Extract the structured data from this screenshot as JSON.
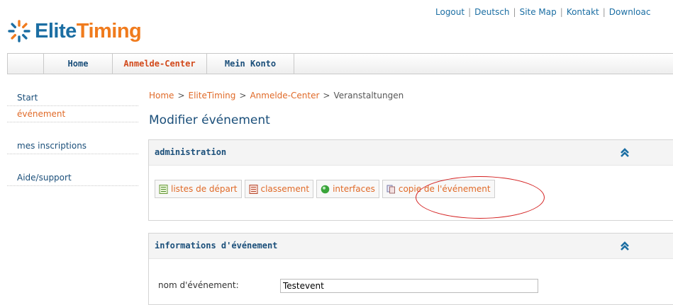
{
  "brand": {
    "part1": "Elite",
    "part2": "Timing",
    "color_blue": "#1b6ea3",
    "color_orange": "#f07b1d",
    "logo_icon": "elitetiming-logo-icon"
  },
  "toplinks": [
    "Logout",
    "Deutsch",
    "Site Map",
    "Kontakt",
    "Downloac"
  ],
  "nav": {
    "tabs": [
      "Home",
      "Anmelde-Center",
      "Mein Konto"
    ]
  },
  "sidebar": {
    "items": [
      "Start",
      "événement",
      "mes inscriptions",
      "Aide/support"
    ]
  },
  "breadcrumb": {
    "items": [
      "Home",
      "EliteTiming",
      "Anmelde-Center",
      "Veranstaltungen"
    ],
    "separator": ">"
  },
  "page": {
    "title": "Modifier événement"
  },
  "admin_panel": {
    "title": "administration",
    "buttons": [
      {
        "label": "listes de départ",
        "icon": "list-icon"
      },
      {
        "label": "classement",
        "icon": "ranking-icon"
      },
      {
        "label": "interfaces",
        "icon": "interfaces-icon"
      },
      {
        "label": "copie de l'événement",
        "icon": "copy-icon"
      }
    ]
  },
  "info_panel": {
    "title": "informations d'événement",
    "field_label": "nom d'événement:",
    "field_value": "Testevent"
  },
  "colors": {
    "accent_orange": "#e06a28",
    "link_blue": "#1b4f7a",
    "highlight_red": "#d42020"
  }
}
